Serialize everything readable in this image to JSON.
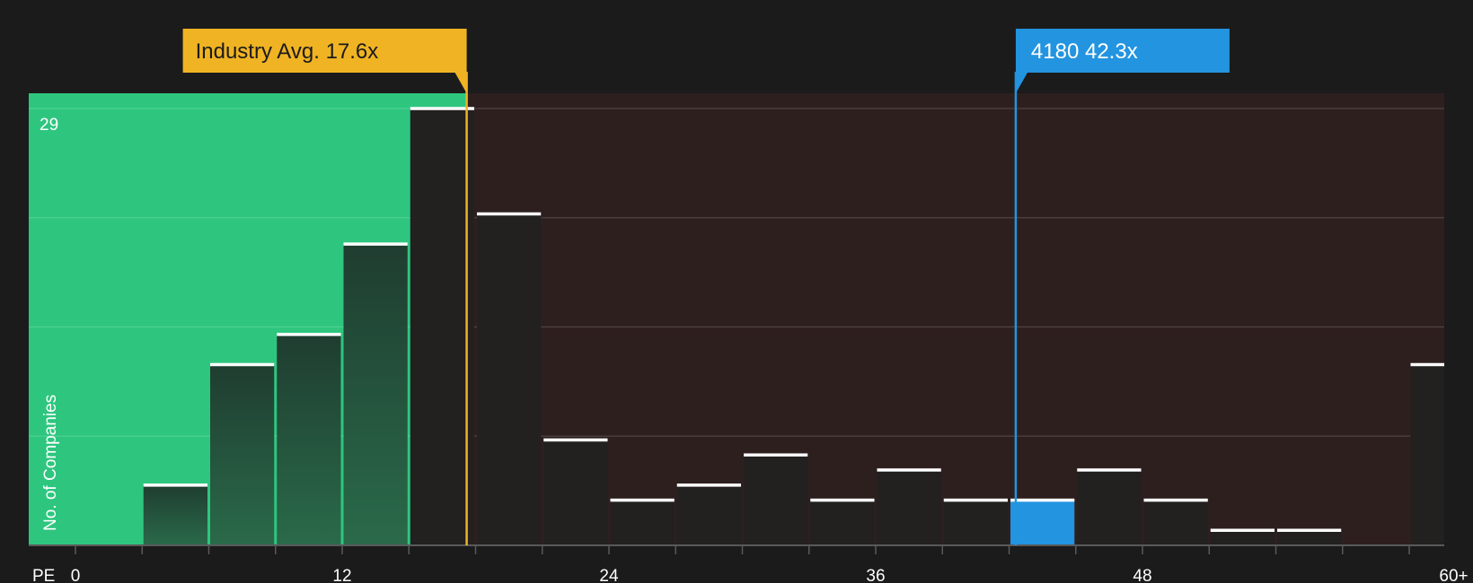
{
  "chart_data": {
    "type": "bar",
    "x_axis_label": "PE",
    "ylabel": "No. of Companies",
    "y_top_label": "29",
    "ylim": [
      0,
      29
    ],
    "y_gridlines": [
      7.25,
      14.5,
      21.75,
      29
    ],
    "x_ticks": [
      {
        "value": 0,
        "label": "0"
      },
      {
        "value": 12,
        "label": "12"
      },
      {
        "value": 24,
        "label": "24"
      },
      {
        "value": 36,
        "label": "36"
      },
      {
        "value": 48,
        "label": "48"
      },
      {
        "value": 62,
        "label": "60+"
      }
    ],
    "bin_width": 3,
    "bins": [
      {
        "start": 0,
        "value": 0
      },
      {
        "start": 3,
        "value": 4
      },
      {
        "start": 6,
        "value": 12
      },
      {
        "start": 9,
        "value": 14
      },
      {
        "start": 12,
        "value": 20
      },
      {
        "start": 15,
        "value": 29
      },
      {
        "start": 18,
        "value": 22
      },
      {
        "start": 21,
        "value": 7
      },
      {
        "start": 24,
        "value": 3
      },
      {
        "start": 27,
        "value": 4
      },
      {
        "start": 30,
        "value": 6
      },
      {
        "start": 33,
        "value": 3
      },
      {
        "start": 36,
        "value": 5
      },
      {
        "start": 39,
        "value": 3
      },
      {
        "start": 42,
        "value": 3,
        "highlight": true
      },
      {
        "start": 45,
        "value": 5
      },
      {
        "start": 48,
        "value": 3
      },
      {
        "start": 51,
        "value": 1
      },
      {
        "start": 54,
        "value": 1
      },
      {
        "start": 57,
        "value": 0
      },
      {
        "start": 60,
        "value": 12,
        "overflow": true
      }
    ],
    "industry_avg": {
      "value": 17.6,
      "label": "Industry Avg. 17.6x"
    },
    "company": {
      "value": 42.3,
      "label": "4180 42.3x"
    },
    "colors": {
      "background": "#1b1b1b",
      "undervalued_zone": "#2ec67f",
      "overvalued_zone": "#2e1f1f",
      "industry_accent": "#f0b323",
      "company_accent": "#2394e0",
      "bar_fill": "#232020",
      "bar_top": "#ffffff"
    }
  }
}
